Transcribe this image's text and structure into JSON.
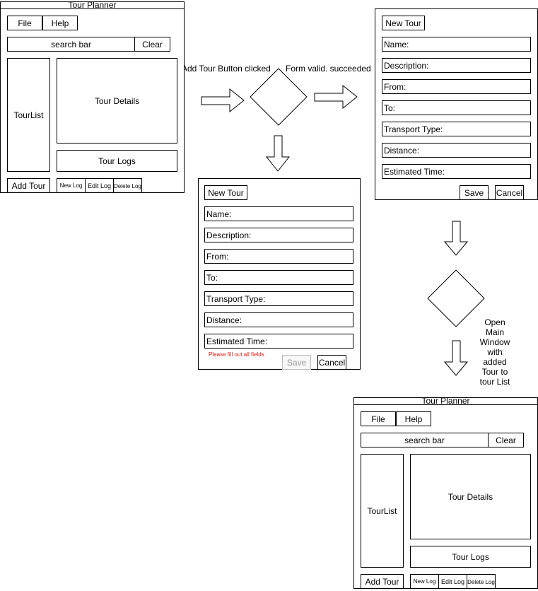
{
  "main_window": {
    "title": "Tour Planner",
    "menu_file": "File",
    "menu_help": "Help",
    "search": "search bar",
    "clear": "Clear",
    "tour_list": "TourList",
    "tour_details": "Tour Details",
    "tour_logs": "Tour Logs",
    "add_tour": "Add Tour",
    "new_log": "New Log",
    "edit_log": "Edit Log",
    "delete_log": "Delete Log"
  },
  "form": {
    "title": "New Tour",
    "fields": [
      "Name:",
      "Description:",
      "From:",
      "To:",
      "Transport Type:",
      "Distance:",
      "Estimated Time:"
    ],
    "save": "Save",
    "cancel": "Cancel",
    "error": "Please fill out all fields"
  },
  "flow": {
    "add_tour_clicked": "Add Tour Button clicked",
    "form_valid": "Form valid. succeeded",
    "open_main": "Open Main Window with added Tour to tour List"
  }
}
